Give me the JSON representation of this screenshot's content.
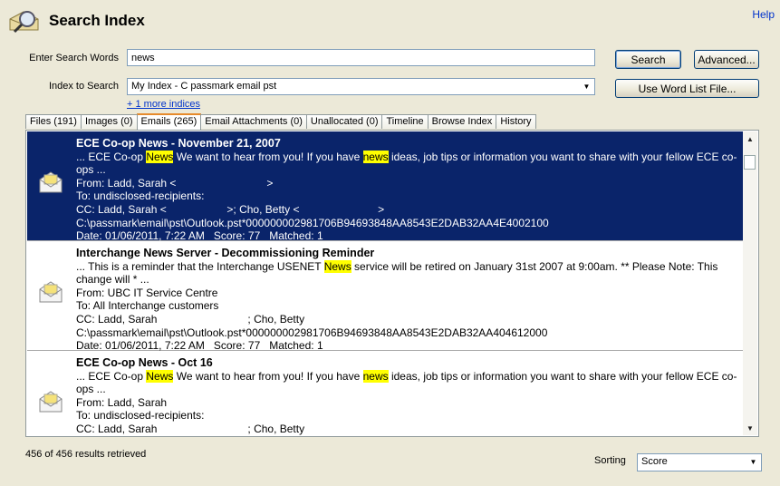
{
  "header": {
    "title": "Search Index",
    "help_label": "Help"
  },
  "form": {
    "search_words_label": "Enter Search Words",
    "search_words_value": "news",
    "index_label": "Index to Search",
    "index_value": "My Index - C passmark email pst",
    "more_indices_link": "+ 1 more indices",
    "search_button": "Search",
    "advanced_button": "Advanced...",
    "word_list_button": "Use Word List File..."
  },
  "tabs": [
    {
      "label": "Files (191)"
    },
    {
      "label": "Images (0)"
    },
    {
      "label": "Emails (265)",
      "active": true
    },
    {
      "label": "Email Attachments (0)"
    },
    {
      "label": "Unallocated (0)"
    },
    {
      "label": "Timeline"
    },
    {
      "label": "Browse Index"
    },
    {
      "label": "History"
    }
  ],
  "results": [
    {
      "title": "ECE Co-op News - November 21, 2007",
      "snippet_a": "... ECE Co-op ",
      "snippet_hl1": "News",
      "snippet_b": " We want to hear from you! If you have ",
      "snippet_hl2": "news",
      "snippet_c": " ideas, job tips or information you want to share with your fellow ECE co-ops ...",
      "from": "From: Ladd, Sarah <                              >",
      "to": "To: undisclosed-recipients:",
      "cc": "CC: Ladd, Sarah <                    >; Cho, Betty <                          >",
      "path": "C:\\passmark\\email\\pst\\Outlook.pst*000000002981706B94693848AA8543E2DAB32AA4E4002100",
      "meta": "Date: 01/06/2011, 7:22 AM   Score: 77   Matched: 1",
      "selected": true
    },
    {
      "title": "Interchange News Server - Decommissioning Reminder",
      "snippet_a": "... This is a reminder that the Interchange USENET ",
      "snippet_hl1": "News",
      "snippet_b": " service will be retired on January 31st 2007 at 9:00am. ** Please Note: This change will * ...",
      "snippet_hl2": "",
      "snippet_c": "",
      "from": "From: UBC IT Service Centre",
      "to": "To: All Interchange customers",
      "cc": "CC: Ladd, Sarah                              ; Cho, Betty",
      "path": "C:\\passmark\\email\\pst\\Outlook.pst*000000002981706B94693848AA8543E2DAB32AA404612000",
      "meta": "Date: 01/06/2011, 7:22 AM   Score: 77   Matched: 1",
      "selected": false
    },
    {
      "title": "ECE Co-op News - Oct 16",
      "snippet_a": "... ECE Co-op ",
      "snippet_hl1": "News",
      "snippet_b": " We want to hear from you! If you have ",
      "snippet_hl2": "news",
      "snippet_c": " ideas, job tips or information you want to share with your fellow ECE co-ops ...",
      "from": "From: Ladd, Sarah",
      "to": "To: undisclosed-recipients:",
      "cc": "CC: Ladd, Sarah                              ; Cho, Betty",
      "path": "",
      "meta": "",
      "selected": false
    }
  ],
  "footer": {
    "status": "456 of 456 results retrieved",
    "sorting_label": "Sorting",
    "sorting_value": "Score"
  },
  "colors": {
    "selection": "#0a246a",
    "highlight": "#ffff00",
    "link": "#0033cc"
  }
}
